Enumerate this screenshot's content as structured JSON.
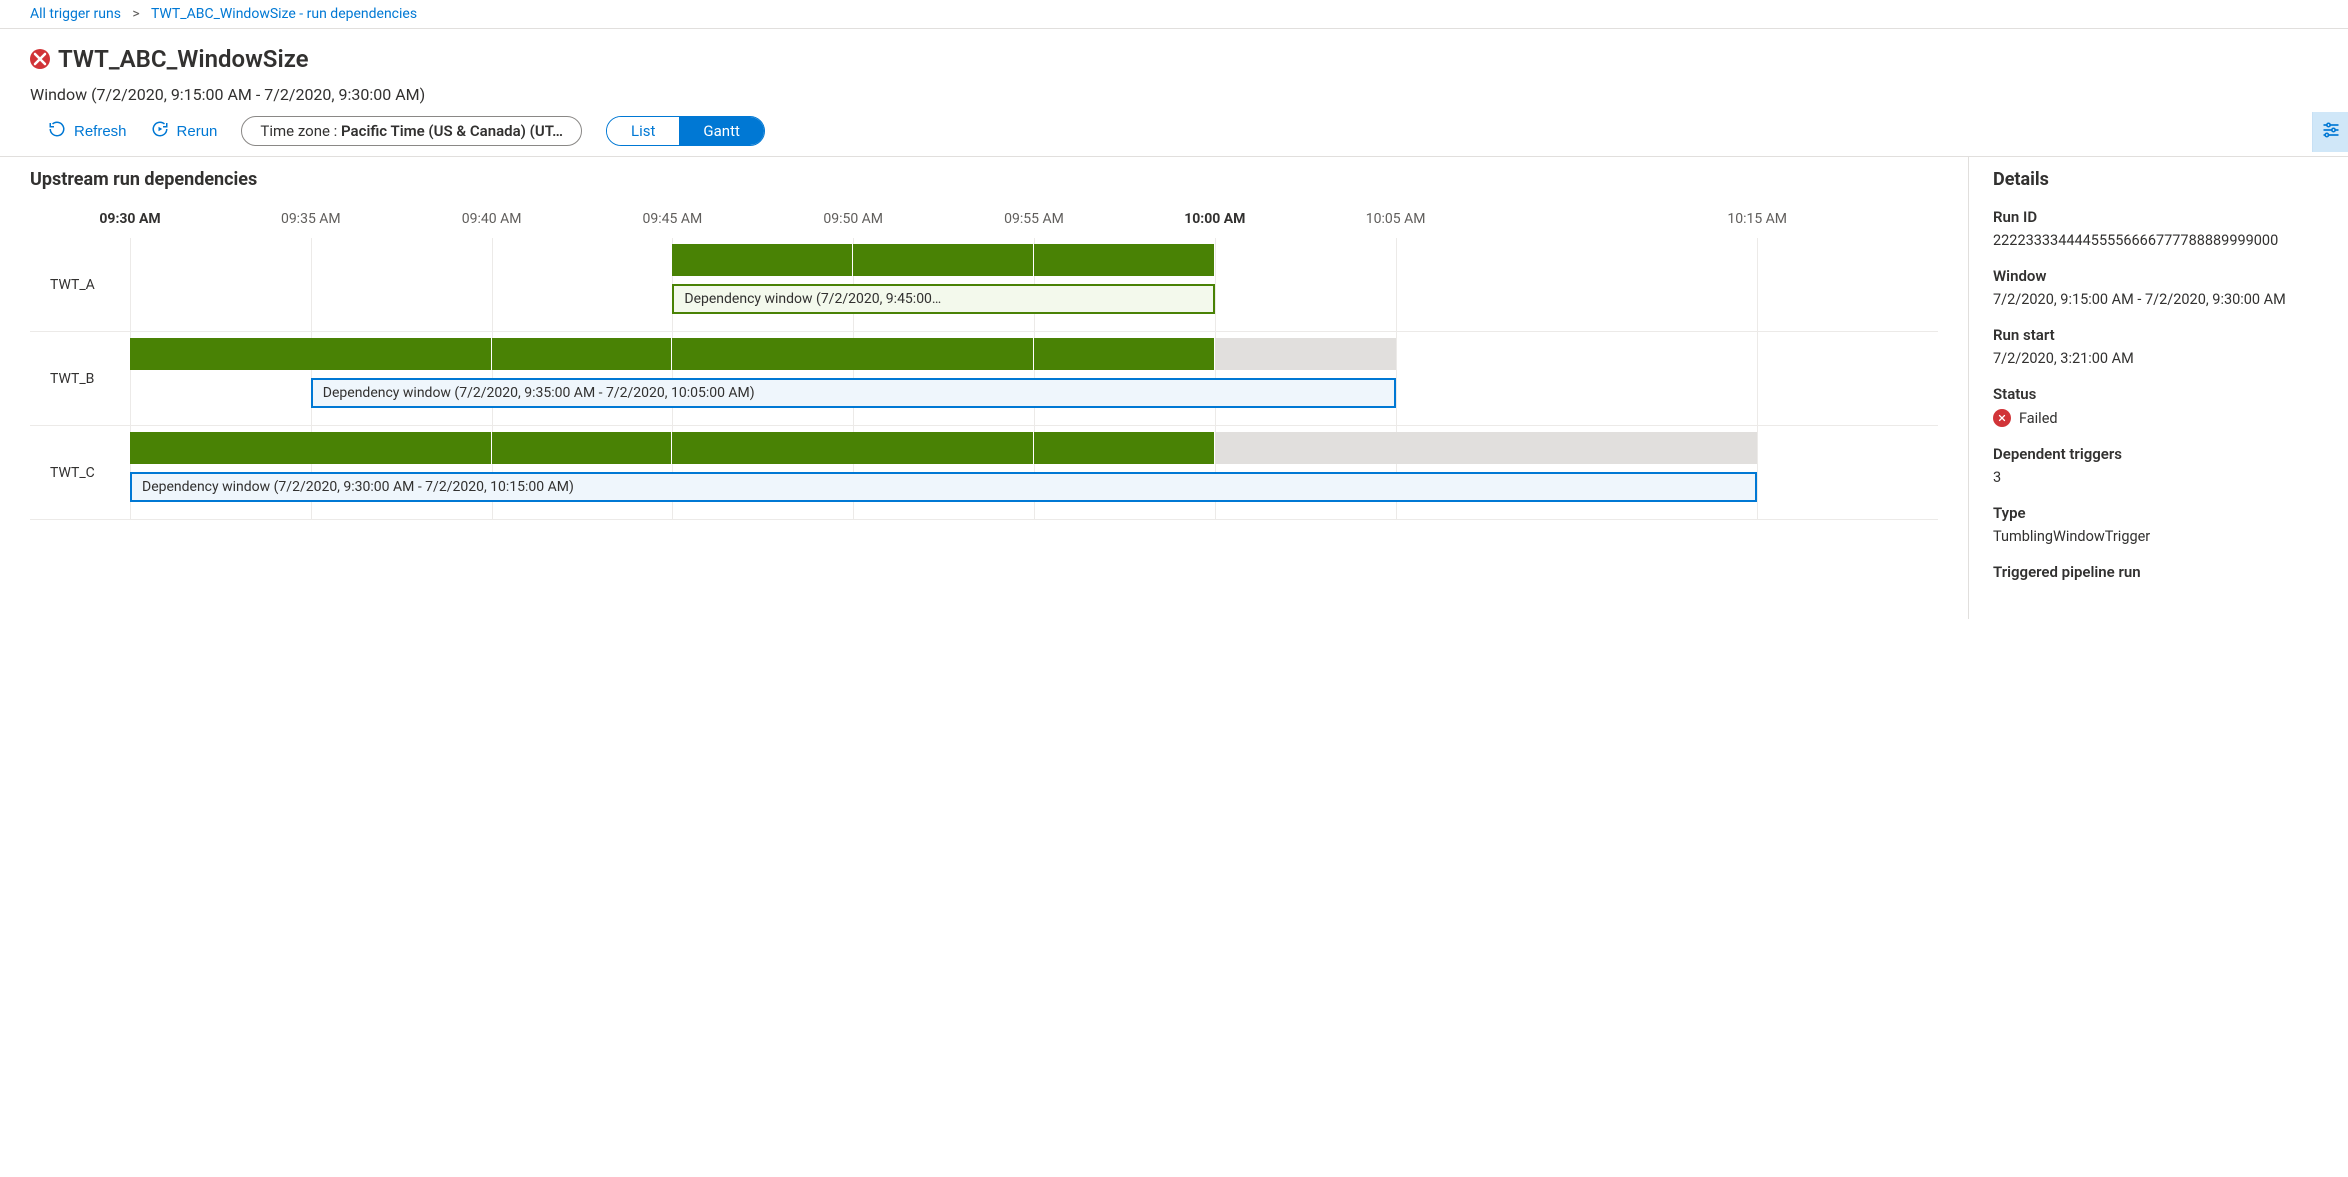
{
  "breadcrumb": {
    "root": "All trigger runs",
    "current": "TWT_ABC_WindowSize - run dependencies"
  },
  "header": {
    "title": "TWT_ABC_WindowSize",
    "window_text": "Window (7/2/2020, 9:15:00 AM - 7/2/2020, 9:30:00 AM)"
  },
  "toolbar": {
    "refresh": "Refresh",
    "rerun": "Rerun",
    "tz_label": "Time zone : ",
    "tz_value": "Pacific Time (US & Canada) (UT…",
    "view_list": "List",
    "view_gantt": "Gantt"
  },
  "gantt": {
    "title": "Upstream run dependencies"
  },
  "details": {
    "title": "Details",
    "fields": {
      "run_id": {
        "k": "Run ID",
        "v": "22223333444455556666777788889999000"
      },
      "window": {
        "k": "Window",
        "v": "7/2/2020, 9:15:00 AM - 7/2/2020, 9:30:00 AM"
      },
      "run_start": {
        "k": "Run start",
        "v": "7/2/2020, 3:21:00 AM"
      },
      "status": {
        "k": "Status",
        "v": "Failed"
      },
      "dep_trig": {
        "k": "Dependent triggers",
        "v": "3"
      },
      "type": {
        "k": "Type",
        "v": "TumblingWindowTrigger"
      },
      "pipeline": {
        "k": "Triggered pipeline run",
        "v": ""
      }
    }
  },
  "colors": {
    "success": "#498205",
    "pending": "#e1dfdd",
    "accent": "#0078d4",
    "error": "#d13438"
  },
  "chart_data": {
    "type": "gantt",
    "x_unit": "minutes",
    "x_domain_start": "09:30",
    "x_domain_end": "10:20",
    "ticks": [
      {
        "label": "09:30 AM",
        "minute": 0,
        "bold": true
      },
      {
        "label": "09:35 AM",
        "minute": 5,
        "bold": false
      },
      {
        "label": "09:40 AM",
        "minute": 10,
        "bold": false
      },
      {
        "label": "09:45 AM",
        "minute": 15,
        "bold": false
      },
      {
        "label": "09:50 AM",
        "minute": 20,
        "bold": false
      },
      {
        "label": "09:55 AM",
        "minute": 25,
        "bold": false
      },
      {
        "label": "10:00 AM",
        "minute": 30,
        "bold": true
      },
      {
        "label": "10:05 AM",
        "minute": 35,
        "bold": false
      },
      {
        "label": "10:15 AM",
        "minute": 45,
        "bold": false
      }
    ],
    "rows": [
      {
        "label": "TWT_A",
        "segments": [
          {
            "start": 15,
            "end": 20,
            "status": "success"
          },
          {
            "start": 20,
            "end": 25,
            "status": "success"
          },
          {
            "start": 25,
            "end": 30,
            "status": "success"
          }
        ],
        "dep_window": {
          "start": 15,
          "end": 30,
          "label": "Dependency window (7/2/2020, 9:45:00…",
          "style": "green"
        }
      },
      {
        "label": "TWT_B",
        "segments": [
          {
            "start": 0,
            "end": 10,
            "status": "success"
          },
          {
            "start": 10,
            "end": 15,
            "status": "success"
          },
          {
            "start": 15,
            "end": 25,
            "status": "success"
          },
          {
            "start": 25,
            "end": 30,
            "status": "success"
          },
          {
            "start": 30,
            "end": 35,
            "status": "pending"
          }
        ],
        "dep_window": {
          "start": 5,
          "end": 35,
          "label": "Dependency window (7/2/2020, 9:35:00 AM - 7/2/2020, 10:05:00 AM)",
          "style": "blue"
        }
      },
      {
        "label": "TWT_C",
        "segments": [
          {
            "start": 0,
            "end": 10,
            "status": "success"
          },
          {
            "start": 10,
            "end": 15,
            "status": "success"
          },
          {
            "start": 15,
            "end": 25,
            "status": "success"
          },
          {
            "start": 25,
            "end": 30,
            "status": "success"
          },
          {
            "start": 30,
            "end": 45,
            "status": "pending"
          }
        ],
        "dep_window": {
          "start": 0,
          "end": 45,
          "label": "Dependency window (7/2/2020, 9:30:00 AM - 7/2/2020, 10:15:00 AM)",
          "style": "blue"
        }
      }
    ]
  }
}
